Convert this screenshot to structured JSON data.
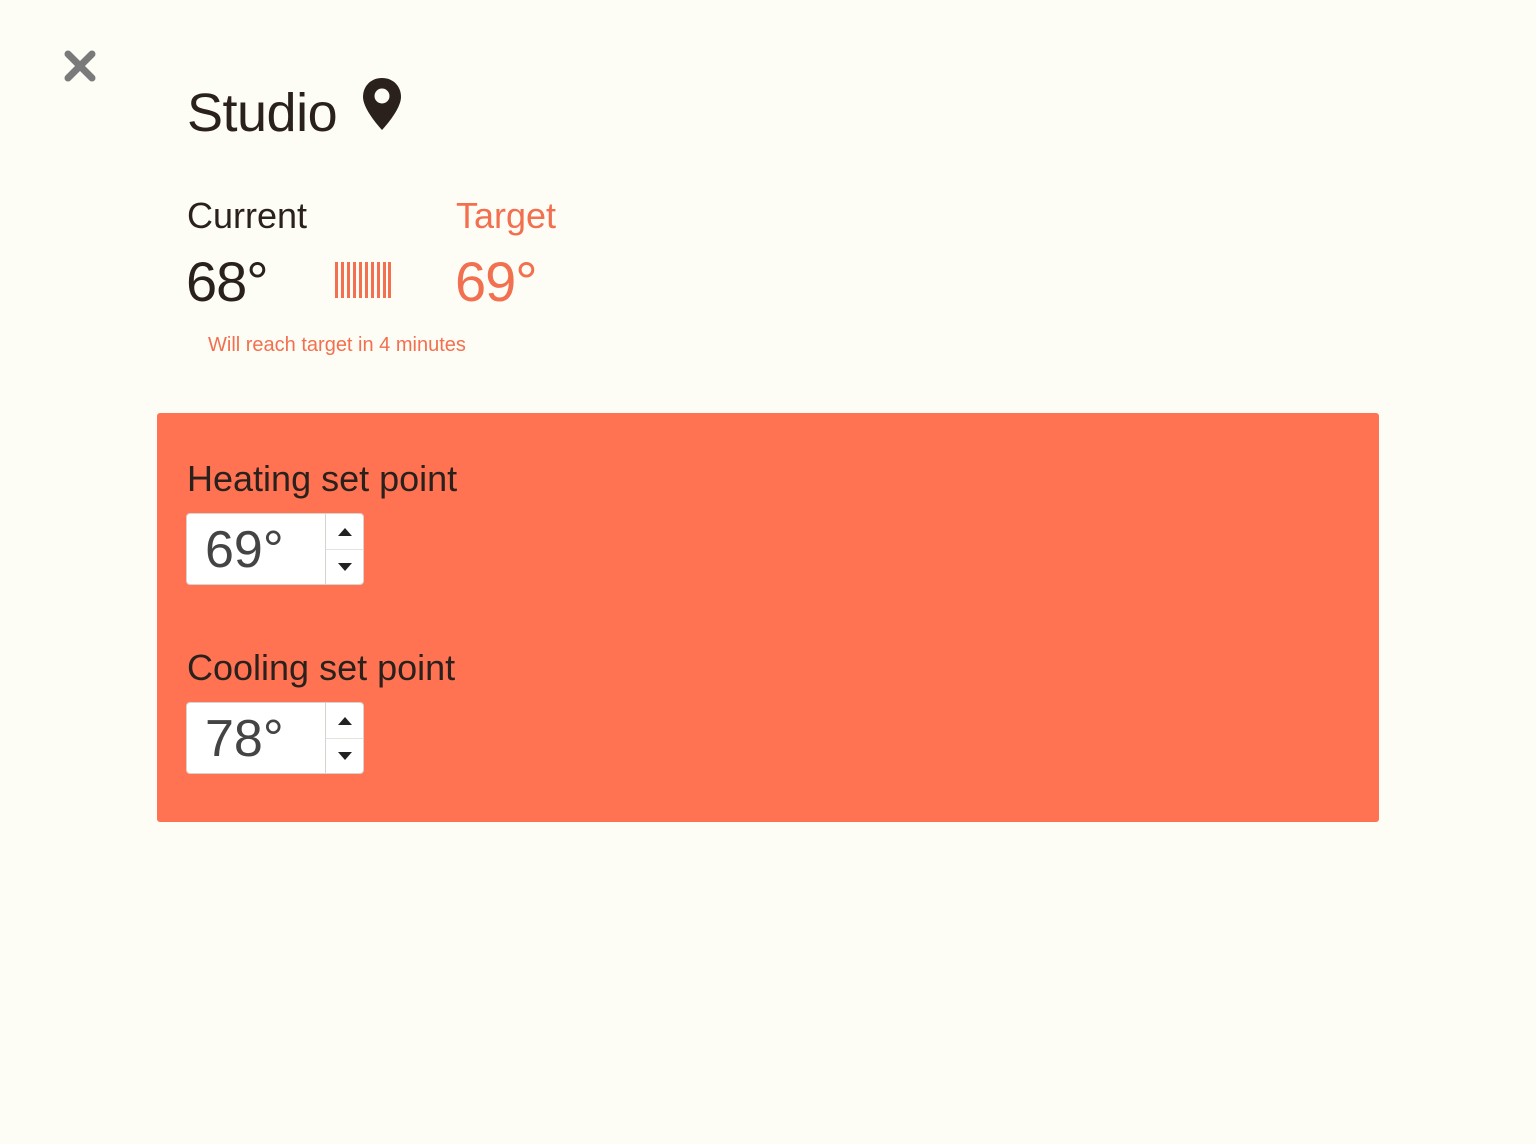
{
  "room": {
    "name": "Studio"
  },
  "status": {
    "current_label": "Current",
    "current_temp": "68°",
    "target_label": "Target",
    "target_temp": "69°",
    "eta_message": "Will reach target in 4 minutes"
  },
  "setpoints": {
    "heating": {
      "label": "Heating set point",
      "value": "69°"
    },
    "cooling": {
      "label": "Cooling set point",
      "value": "78°"
    }
  },
  "icons": {
    "close": "close-icon",
    "location": "map-pin-icon",
    "heating": "heating-indicator-icon",
    "increment": "triangle-up-icon",
    "decrement": "triangle-down-icon"
  },
  "colors": {
    "background": "#fdfdf6",
    "accent": "#f2704f",
    "panel": "#ff7352",
    "text": "#2a211d"
  }
}
